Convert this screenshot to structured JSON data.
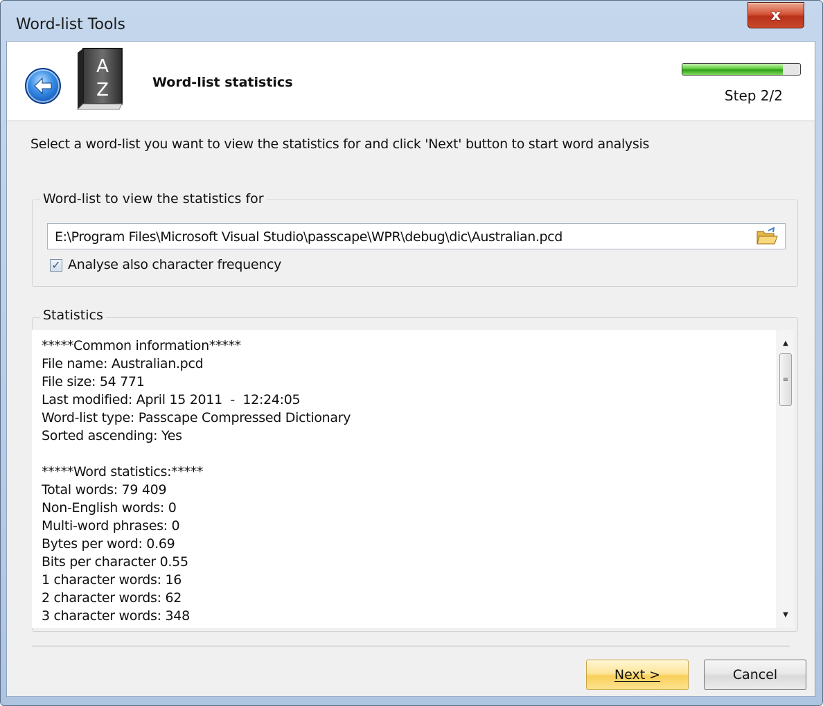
{
  "window": {
    "title": "Word-list Tools",
    "close_label": "x"
  },
  "header": {
    "title": "Word-list statistics",
    "step": "Step 2/2",
    "progress_fraction": 0.85,
    "book_icon_letters": [
      "A",
      "Z"
    ]
  },
  "instruction": "Select a word-list you want to view the statistics for and click 'Next' button to start word analysis",
  "wordlist_group": {
    "label": "Word-list to view the statistics for",
    "path_value": "E:\\Program Files\\Microsoft Visual Studio\\passcape\\WPR\\debug\\dic\\Australian.pcd",
    "checkbox_label": "Analyse also character frequency",
    "checkbox_checked": true
  },
  "stats_group": {
    "label": "Statistics",
    "lines": [
      "*****Common information*****",
      "File name: Australian.pcd",
      "File size: 54 771",
      "Last modified: April 15 2011  -  12:24:05",
      "Word-list type: Passcape Compressed Dictionary",
      "Sorted ascending: Yes",
      "",
      "*****Word statistics:*****",
      "Total words: 79 409",
      "Non-English words: 0",
      "Multi-word phrases: 0",
      "Bytes per word: 0.69",
      "Bits per character 0.55",
      "1 character words: 16",
      "2 character words: 62",
      "3 character words: 348"
    ]
  },
  "buttons": {
    "next": "Next >",
    "cancel": "Cancel"
  },
  "icons": {
    "back": "back-arrow-icon",
    "book": "dictionary-book-icon",
    "folder": "open-folder-icon",
    "close": "close-icon"
  },
  "colors": {
    "close_button": "#c8492d",
    "progress": "#5fcf3a",
    "next_button": "#f8cf5a",
    "back_button": "#3b8fe6"
  }
}
